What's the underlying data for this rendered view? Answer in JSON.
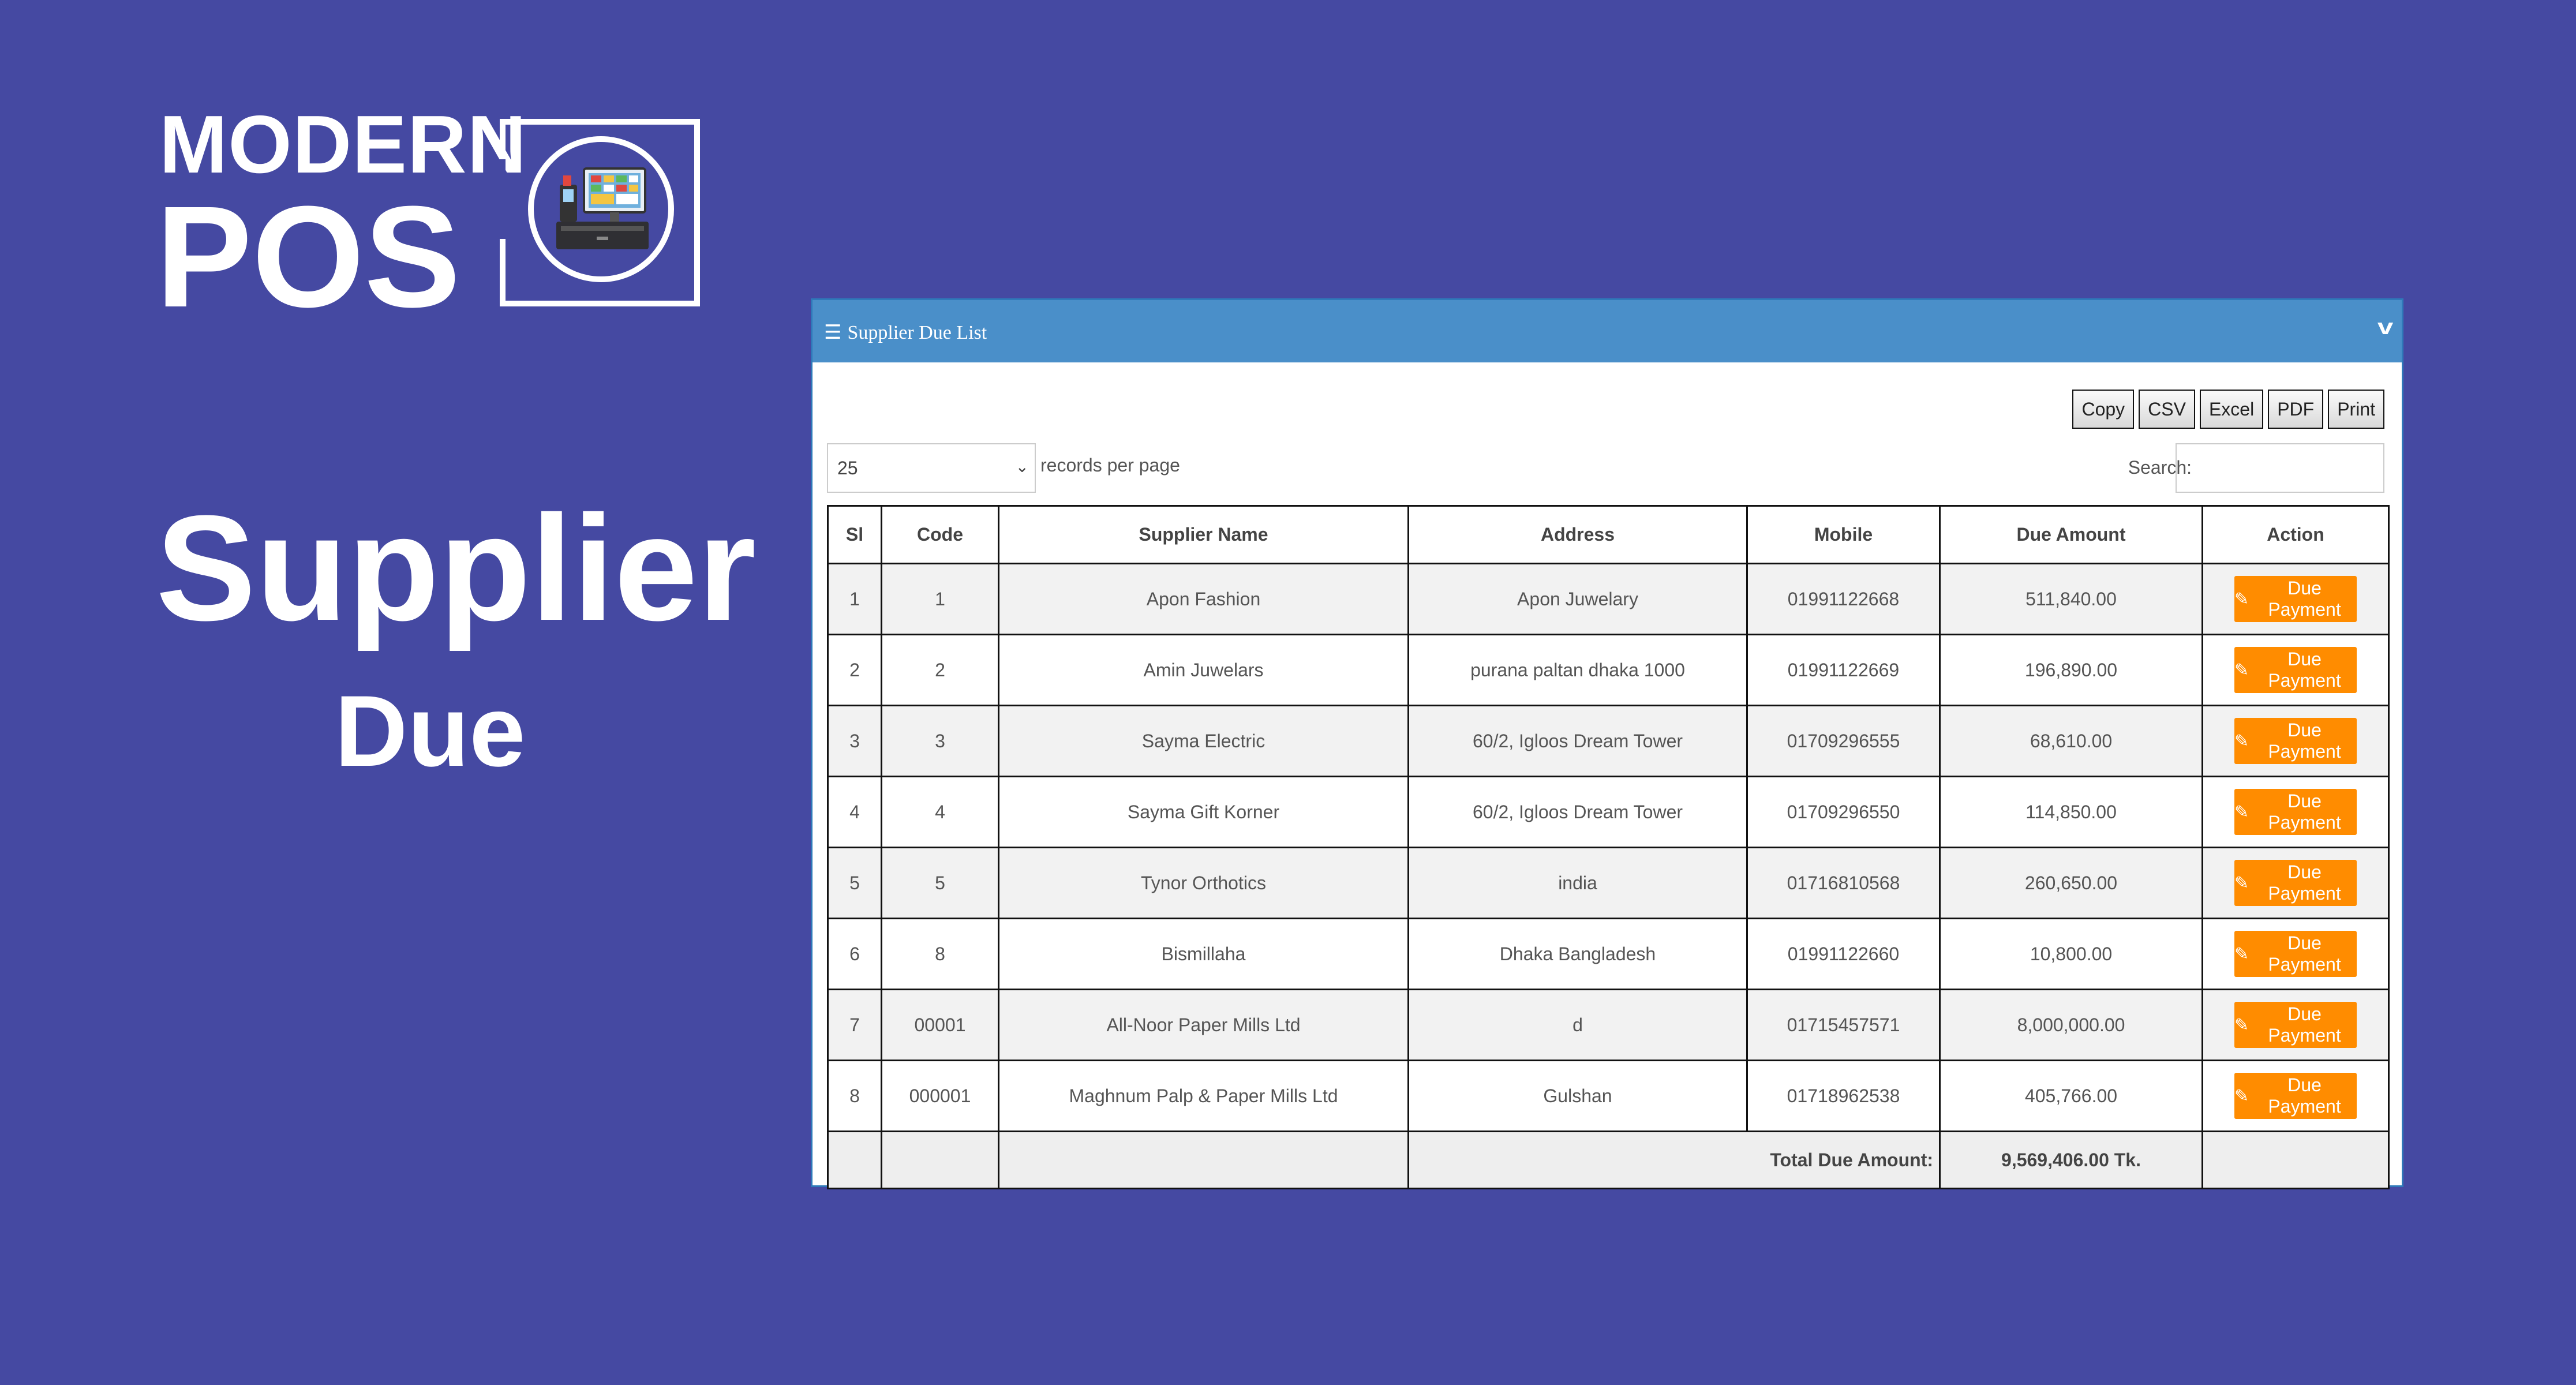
{
  "brand": {
    "line1": "MODERN",
    "line2": "POS",
    "icon": "pos-terminal-icon"
  },
  "hero": {
    "title": "Supplier",
    "subtitle": "Due"
  },
  "panel": {
    "title": "Supplier Due List",
    "menu_icon": "☰",
    "collapse_icon": "v",
    "export_buttons": [
      "Copy",
      "CSV",
      "Excel",
      "PDF",
      "Print"
    ],
    "length": {
      "value": "25",
      "label": "records per page"
    },
    "search": {
      "label": "Search:",
      "value": ""
    }
  },
  "table": {
    "headers": [
      "Sl",
      "Code",
      "Supplier Name",
      "Address",
      "Mobile",
      "Due Amount",
      "Action"
    ],
    "rows": [
      {
        "sl": "1",
        "code": "1",
        "name": "Apon Fashion",
        "address": "Apon Juwelary",
        "mobile": "01991122668",
        "due": "511,840.00",
        "action": "Due Payment"
      },
      {
        "sl": "2",
        "code": "2",
        "name": "Amin Juwelars",
        "address": "purana paltan dhaka 1000",
        "mobile": "01991122669",
        "due": "196,890.00",
        "action": "Due Payment"
      },
      {
        "sl": "3",
        "code": "3",
        "name": "Sayma Electric",
        "address": "60/2, Igloos Dream Tower",
        "mobile": "01709296555",
        "due": "68,610.00",
        "action": "Due Payment"
      },
      {
        "sl": "4",
        "code": "4",
        "name": "Sayma Gift Korner",
        "address": "60/2, Igloos Dream Tower",
        "mobile": "01709296550",
        "due": "114,850.00",
        "action": "Due Payment"
      },
      {
        "sl": "5",
        "code": "5",
        "name": "Tynor Orthotics",
        "address": "india",
        "mobile": "01716810568",
        "due": "260,650.00",
        "action": "Due Payment"
      },
      {
        "sl": "6",
        "code": "8",
        "name": "Bismillaha",
        "address": "Dhaka Bangladesh",
        "mobile": "01991122660",
        "due": "10,800.00",
        "action": "Due Payment"
      },
      {
        "sl": "7",
        "code": "00001",
        "name": "All-Noor Paper Mills Ltd",
        "address": "d",
        "mobile": "01715457571",
        "due": "8,000,000.00",
        "action": "Due Payment"
      },
      {
        "sl": "8",
        "code": "000001",
        "name": "Maghnum Palp & Paper Mills Ltd",
        "address": "Gulshan",
        "mobile": "01718962538",
        "due": "405,766.00",
        "action": "Due Payment"
      }
    ],
    "footer": {
      "label": "Total Due Amount:",
      "total": "9,569,406.00 Tk."
    }
  }
}
